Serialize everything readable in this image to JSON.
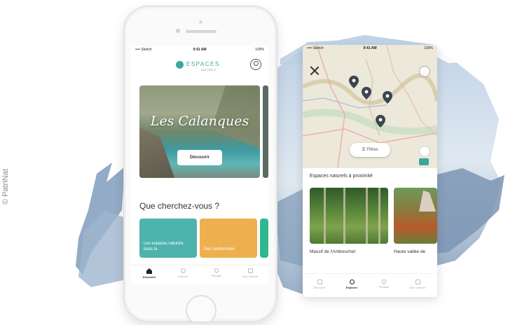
{
  "copyright": "© PatriNat",
  "colors": {
    "brand": "#3aa79a",
    "orange": "#eeb04e",
    "green": "#2fb88f",
    "pin": "#3b4650"
  },
  "phone_home": {
    "status": {
      "carrier": "•••• Sketch",
      "time": "9:41 AM",
      "battery": "100%"
    },
    "logo": {
      "name": "ESPACES",
      "sub": "NATURELS"
    },
    "hero": {
      "title": "Les Calanques",
      "button": "Découvrir"
    },
    "question": "Que cherchez-vous ?",
    "categories": [
      {
        "label": "Les espaces naturels dans la"
      },
      {
        "label": "Des randonnées"
      },
      {
        "label": ""
      }
    ],
    "tabs": [
      {
        "label": "Découvrir",
        "icon": "home-icon"
      },
      {
        "label": "Explorer",
        "icon": "search-icon"
      },
      {
        "label": "Partager",
        "icon": "pin-icon"
      },
      {
        "label": "Mon compte",
        "icon": "account-icon"
      }
    ]
  },
  "phone_map": {
    "status": {
      "carrier": "•••• Sketch",
      "time": "9:41 AM",
      "battery": "100%"
    },
    "filter_label": "Filtres",
    "section_title": "Espaces naturels à proximité",
    "cards": [
      {
        "label": "Massif de l'Ambouchet"
      },
      {
        "label": "Haute vallée de"
      }
    ],
    "tabs": [
      {
        "label": "Découvrir",
        "icon": "home-icon"
      },
      {
        "label": "Explorer",
        "icon": "search-icon"
      },
      {
        "label": "Partager",
        "icon": "pin-icon"
      },
      {
        "label": "Mon compte",
        "icon": "account-icon"
      }
    ]
  }
}
